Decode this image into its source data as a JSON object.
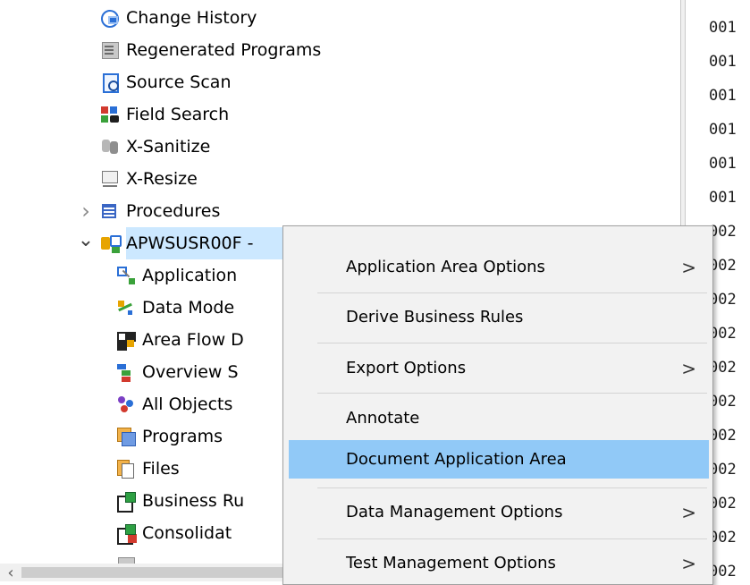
{
  "tree": {
    "items": [
      {
        "label": "Change History",
        "icon": "change-history-icon"
      },
      {
        "label": "Regenerated Programs",
        "icon": "regenerated-programs-icon"
      },
      {
        "label": "Source Scan",
        "icon": "source-scan-icon"
      },
      {
        "label": "Field Search",
        "icon": "field-search-icon"
      },
      {
        "label": "X-Sanitize",
        "icon": "x-sanitize-icon"
      },
      {
        "label": "X-Resize",
        "icon": "x-resize-icon"
      },
      {
        "label": "Procedures",
        "icon": "procedures-icon",
        "expand": "collapsed"
      },
      {
        "label": "APWSUSR00F - ",
        "icon": "application-area-icon",
        "expand": "expanded",
        "selected": true
      },
      {
        "label": "Application",
        "icon": "application-diagram-icon"
      },
      {
        "label": "Data Mode",
        "icon": "data-model-icon"
      },
      {
        "label": "Area Flow D",
        "icon": "area-flow-icon"
      },
      {
        "label": "Overview S",
        "icon": "overview-icon"
      },
      {
        "label": "All Objects",
        "icon": "all-objects-icon"
      },
      {
        "label": "Programs",
        "icon": "programs-icon"
      },
      {
        "label": "Files",
        "icon": "files-icon"
      },
      {
        "label": "Business Ru",
        "icon": "business-rules-icon"
      },
      {
        "label": "Consolidat",
        "icon": "consolidated-icon"
      },
      {
        "label": "",
        "icon": "source-icon"
      }
    ]
  },
  "code_pane": {
    "line_numbers": [
      "001",
      "001",
      "001",
      "001",
      "001",
      "001",
      "002",
      "002",
      "002",
      "002",
      "002",
      "002",
      "002",
      "002",
      "002",
      "002",
      "002"
    ]
  },
  "context_menu": {
    "items": [
      {
        "label": "Application Area Options",
        "submenu": true
      },
      {
        "label": "Derive Business Rules",
        "submenu": false
      },
      {
        "label": "Export Options",
        "submenu": true
      },
      {
        "label": "Annotate",
        "submenu": false
      },
      {
        "label": "Document Application Area",
        "submenu": false,
        "highlighted": true
      },
      {
        "label": "Data Management Options",
        "submenu": true
      },
      {
        "label": "Test Management Options",
        "submenu": true
      }
    ],
    "submenu_arrow": ">"
  },
  "glyphs": {
    "chevron_right": "›",
    "chevron_down": "⌄",
    "scroll_left": "‹"
  },
  "colors": {
    "selection": "#cce8ff",
    "menu_highlight": "#91c9f7",
    "menu_background": "#f2f2f2"
  }
}
